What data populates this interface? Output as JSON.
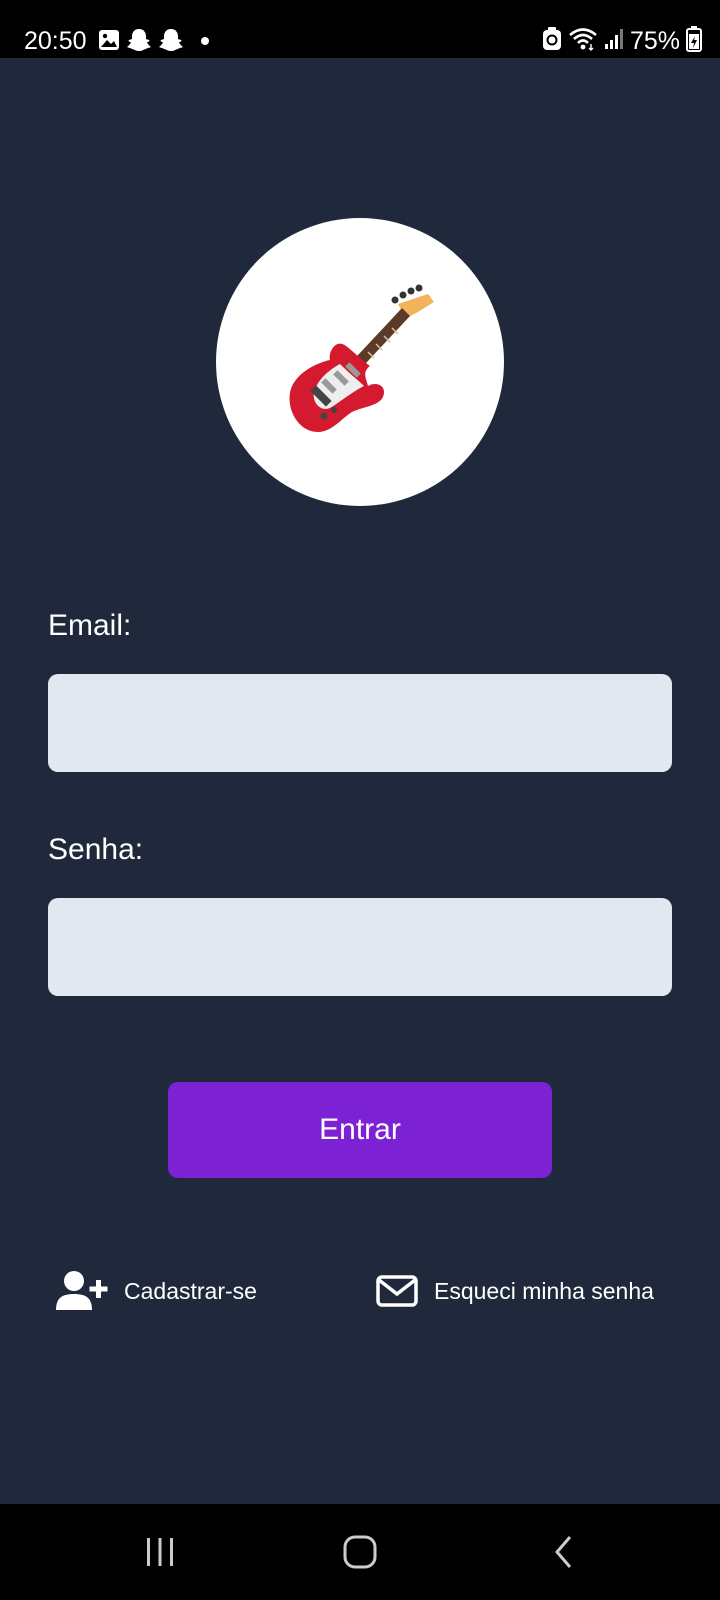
{
  "status_bar": {
    "time": "20:50",
    "battery_percent": "75%",
    "left_icons": [
      "gallery-notification-icon",
      "snapchat-icon",
      "snapchat-icon",
      "dot-icon"
    ],
    "right_icons": [
      "battery-saver-icon",
      "wifi-icon",
      "signal-icon",
      "battery-icon"
    ]
  },
  "logo": {
    "icon": "guitar-icon"
  },
  "form": {
    "email_label": "Email:",
    "email_value": "",
    "password_label": "Senha:",
    "password_value": "",
    "submit_label": "Entrar"
  },
  "links": {
    "register_label": "Cadastrar-se",
    "register_icon": "user-plus-icon",
    "forgot_label": "Esqueci minha senha",
    "forgot_icon": "envelope-icon"
  },
  "nav_bar": {
    "buttons": [
      "recent-apps-icon",
      "home-icon",
      "back-icon"
    ]
  },
  "colors": {
    "background": "#1f293b",
    "input_background": "#e2e8f0",
    "button_background": "#7c22d4",
    "text": "#ffffff"
  }
}
